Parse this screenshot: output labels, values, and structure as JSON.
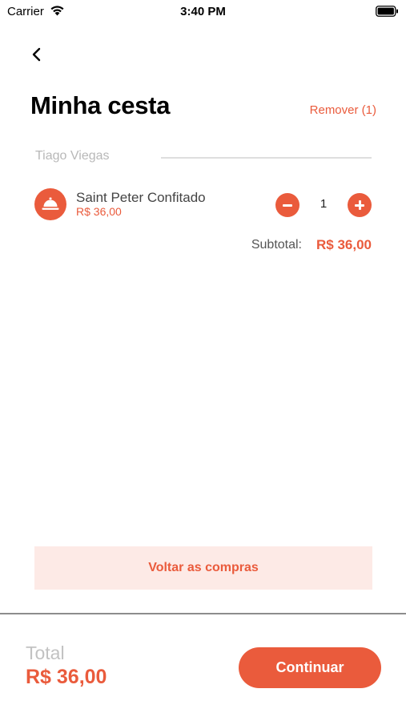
{
  "status_bar": {
    "carrier": "Carrier",
    "time": "3:40 PM"
  },
  "header": {
    "title": "Minha cesta",
    "remove_label": "Remover (1)"
  },
  "store": {
    "name": "Tiago Viegas"
  },
  "cart_item": {
    "name": "Saint Peter Confitado",
    "price": "R$ 36,00",
    "quantity": "1",
    "icon": "service-bell-icon"
  },
  "subtotal": {
    "label": "Subtotal:",
    "value": "R$ 36,00"
  },
  "actions": {
    "back_to_shopping": "Voltar as compras"
  },
  "footer": {
    "total_label": "Total",
    "total_value": "R$ 36,00",
    "continue_label": "Continuar"
  },
  "colors": {
    "accent": "#ea5b3c",
    "accent_light": "#fdeae6",
    "muted_text": "#b8b8b8"
  }
}
